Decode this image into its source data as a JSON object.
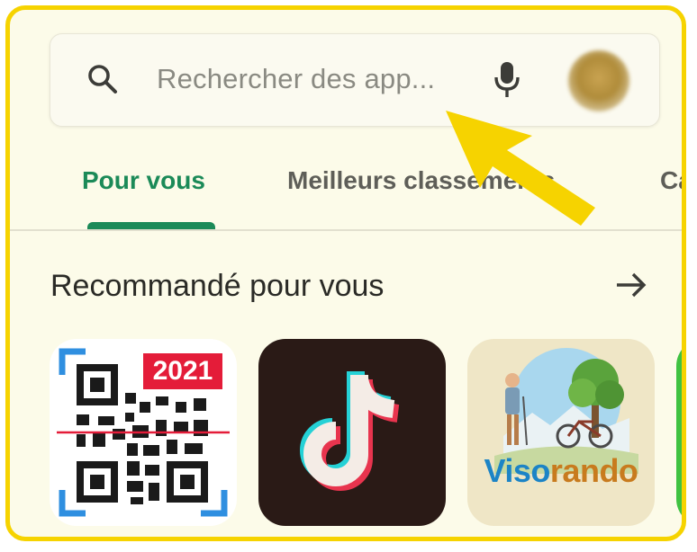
{
  "search": {
    "placeholder": "Rechercher des app...",
    "search_icon": "search-icon",
    "mic_icon": "mic-icon",
    "avatar_icon": "avatar"
  },
  "tabs": [
    {
      "label": "Pour vous",
      "selected": true
    },
    {
      "label": "Meilleurs classements",
      "selected": false
    },
    {
      "label": "Cat",
      "selected": false
    }
  ],
  "section": {
    "title": "Recommandé pour vous",
    "more_icon": "arrow-right-icon"
  },
  "apps": [
    {
      "name": "QR Scanner",
      "badge": "2021",
      "icon": "qr-code-icon"
    },
    {
      "name": "TikTok",
      "icon": "tiktok-icon"
    },
    {
      "name": "Visorando",
      "label_part1": "Viso",
      "label_part2": "rando",
      "icon": "visorando-icon"
    },
    {
      "name": "green app",
      "icon": "app-icon"
    }
  ],
  "colors": {
    "highlight_border": "#f6d300",
    "accent_green": "#1b8a58",
    "background": "#fcfbe9",
    "annotation_arrow": "#f6d300"
  }
}
